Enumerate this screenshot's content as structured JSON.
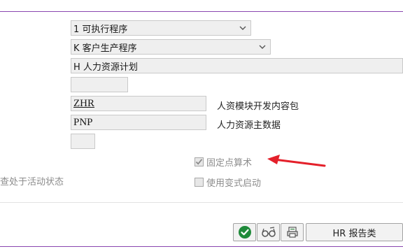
{
  "form": {
    "program_type": {
      "value": "1 可执行程序"
    },
    "status": {
      "value": "K 客户生产程序"
    },
    "application": {
      "value": "H 人力资源计划"
    },
    "auth_group": {
      "value": ""
    },
    "package": {
      "value": "ZHR",
      "description": "人资模块开发内容包"
    },
    "logical_db": {
      "value": "PNP",
      "description": "人力资源主数据"
    },
    "selection_screen": {
      "value": ""
    }
  },
  "checkboxes": {
    "fixed_point": {
      "label": "固定点算术",
      "checked": true
    },
    "variant_start": {
      "label": "使用变式启动",
      "checked": false
    }
  },
  "left_cut_text": "查处于活动状态",
  "annotation": {
    "arrow_color": "#e4202a"
  },
  "toolbar": {
    "hr_report_class_label": "HR 报告类",
    "icons": [
      "checkmark-icon",
      "glasses-icon",
      "print-icon"
    ]
  },
  "colors": {
    "accent": "#8a46b0",
    "check_green": "#1f8a3a"
  }
}
